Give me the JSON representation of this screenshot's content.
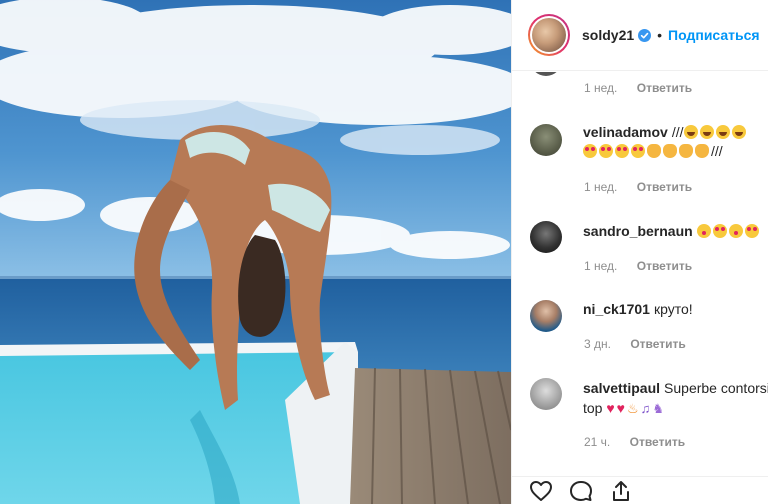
{
  "post": {
    "username": "soldy21",
    "dot": "•",
    "follow_label": "Подписаться"
  },
  "comments": [
    {
      "username": "",
      "text": "",
      "time": "1 нед.",
      "reply": "Ответить"
    },
    {
      "username": "velinadamov",
      "text": "///",
      "text_suffix": "///",
      "time": "1 нед.",
      "reply": "Ответить"
    },
    {
      "username": "sandro_bernaun",
      "text": "",
      "time": "1 нед.",
      "reply": "Ответить"
    },
    {
      "username": "ni_ck1701",
      "text": "круто!",
      "time": "3 дн.",
      "reply": "Ответить"
    },
    {
      "username": "salvettipaul",
      "text": "Superbe contorsi",
      "text_line2": "top",
      "time": "21 ч.",
      "reply": "Ответить"
    }
  ],
  "icons": {
    "verified": "verified-badge-icon",
    "like": "heart-icon",
    "comment": "comment-icon",
    "share": "share-icon"
  },
  "colors": {
    "accent": "#0095f6",
    "meta": "#8e8e8e",
    "text": "#262626"
  }
}
